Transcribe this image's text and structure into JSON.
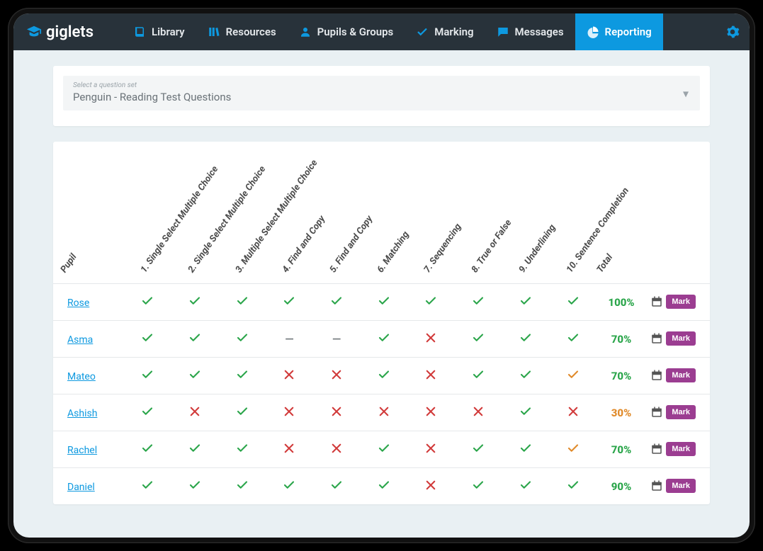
{
  "brand": "giglets",
  "nav": {
    "library": "Library",
    "resources": "Resources",
    "pupils": "Pupils & Groups",
    "marking": "Marking",
    "messages": "Messages",
    "reporting": "Reporting"
  },
  "selector": {
    "label": "Select a question set",
    "value": "Penguin - Reading Test Questions"
  },
  "headers": {
    "pupil": "Pupil",
    "q1": "1. Single Select Multiple Choice",
    "q2": "2. Single Select Multiple Choice",
    "q3": "3. Multiple Select Multiple Choice",
    "q4": "4. Find and Copy",
    "q5": "5. Find and Copy",
    "q6": "6. Matching",
    "q7": "7. Sequencing",
    "q8": "8. True or False",
    "q9": "9. Underlining",
    "q10": "10. Sentence Completion",
    "total": "Total"
  },
  "mark_label": "Mark",
  "pupils": [
    {
      "name": "Rose",
      "answers": [
        "c",
        "c",
        "c",
        "c",
        "c",
        "c",
        "c",
        "c",
        "c",
        "c"
      ],
      "total": "100%",
      "status": "good"
    },
    {
      "name": "Asma",
      "answers": [
        "c",
        "c",
        "c",
        "d",
        "d",
        "c",
        "w",
        "c",
        "c",
        "c"
      ],
      "total": "70%",
      "status": "good"
    },
    {
      "name": "Mateo",
      "answers": [
        "c",
        "c",
        "c",
        "w",
        "w",
        "c",
        "w",
        "c",
        "c",
        "p"
      ],
      "total": "70%",
      "status": "good"
    },
    {
      "name": "Ashish",
      "answers": [
        "c",
        "w",
        "c",
        "w",
        "w",
        "w",
        "w",
        "w",
        "c",
        "w"
      ],
      "total": "30%",
      "status": "bad"
    },
    {
      "name": "Rachel",
      "answers": [
        "c",
        "c",
        "c",
        "w",
        "w",
        "c",
        "w",
        "c",
        "c",
        "p"
      ],
      "total": "70%",
      "status": "good"
    },
    {
      "name": "Daniel",
      "answers": [
        "c",
        "c",
        "c",
        "c",
        "c",
        "c",
        "w",
        "c",
        "c",
        "c"
      ],
      "total": "90%",
      "status": "good"
    }
  ]
}
